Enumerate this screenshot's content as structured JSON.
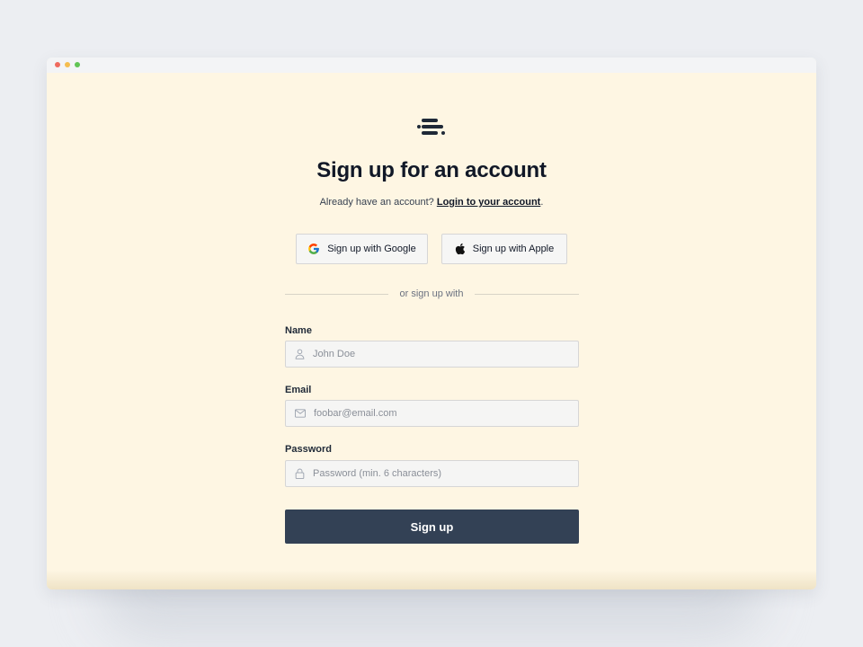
{
  "window": {
    "controls": [
      "close",
      "minimize",
      "maximize"
    ]
  },
  "logo": {
    "icon": "stacked-bars-logo-icon"
  },
  "heading": {
    "title": "Sign up for an account"
  },
  "subtitle": {
    "text": "Already have an account?",
    "link_label": "Login to your account",
    "suffix": "."
  },
  "social": {
    "google_label": "Sign up with Google",
    "google_icon": "google-icon",
    "apple_label": "Sign up with Apple",
    "apple_icon": "apple-icon"
  },
  "divider": {
    "text": "or sign up with"
  },
  "form": {
    "name": {
      "label": "Name",
      "placeholder": "John Doe",
      "value": "",
      "icon": "user-icon"
    },
    "email": {
      "label": "Email",
      "placeholder": "foobar@email.com",
      "value": "",
      "icon": "mail-icon"
    },
    "password": {
      "label": "Password",
      "placeholder": "Password (min. 6 characters)",
      "value": "",
      "icon": "lock-icon"
    },
    "submit_label": "Sign up"
  },
  "colors": {
    "page_background": "#eceef2",
    "card_background": "#fef6e3",
    "primary_button": "#334155",
    "heading_text": "#111827"
  }
}
